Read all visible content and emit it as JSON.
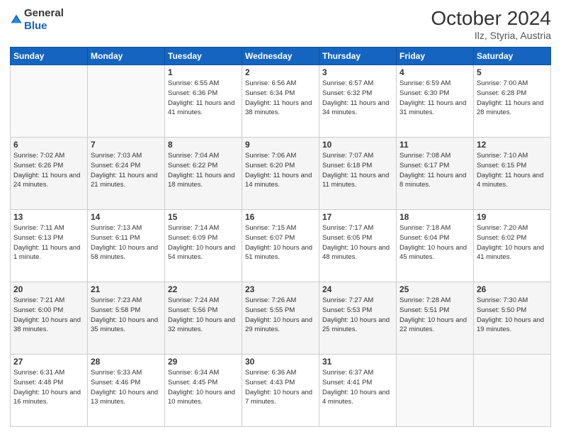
{
  "logo": {
    "text_general": "General",
    "text_blue": "Blue"
  },
  "title": {
    "month_year": "October 2024",
    "location": "Ilz, Styria, Austria"
  },
  "weekdays": [
    "Sunday",
    "Monday",
    "Tuesday",
    "Wednesday",
    "Thursday",
    "Friday",
    "Saturday"
  ],
  "weeks": [
    [
      {
        "day": "",
        "info": ""
      },
      {
        "day": "",
        "info": ""
      },
      {
        "day": "1",
        "info": "Sunrise: 6:55 AM\nSunset: 6:36 PM\nDaylight: 11 hours and 41 minutes."
      },
      {
        "day": "2",
        "info": "Sunrise: 6:56 AM\nSunset: 6:34 PM\nDaylight: 11 hours and 38 minutes."
      },
      {
        "day": "3",
        "info": "Sunrise: 6:57 AM\nSunset: 6:32 PM\nDaylight: 11 hours and 34 minutes."
      },
      {
        "day": "4",
        "info": "Sunrise: 6:59 AM\nSunset: 6:30 PM\nDaylight: 11 hours and 31 minutes."
      },
      {
        "day": "5",
        "info": "Sunrise: 7:00 AM\nSunset: 6:28 PM\nDaylight: 11 hours and 28 minutes."
      }
    ],
    [
      {
        "day": "6",
        "info": "Sunrise: 7:02 AM\nSunset: 6:26 PM\nDaylight: 11 hours and 24 minutes."
      },
      {
        "day": "7",
        "info": "Sunrise: 7:03 AM\nSunset: 6:24 PM\nDaylight: 11 hours and 21 minutes."
      },
      {
        "day": "8",
        "info": "Sunrise: 7:04 AM\nSunset: 6:22 PM\nDaylight: 11 hours and 18 minutes."
      },
      {
        "day": "9",
        "info": "Sunrise: 7:06 AM\nSunset: 6:20 PM\nDaylight: 11 hours and 14 minutes."
      },
      {
        "day": "10",
        "info": "Sunrise: 7:07 AM\nSunset: 6:18 PM\nDaylight: 11 hours and 11 minutes."
      },
      {
        "day": "11",
        "info": "Sunrise: 7:08 AM\nSunset: 6:17 PM\nDaylight: 11 hours and 8 minutes."
      },
      {
        "day": "12",
        "info": "Sunrise: 7:10 AM\nSunset: 6:15 PM\nDaylight: 11 hours and 4 minutes."
      }
    ],
    [
      {
        "day": "13",
        "info": "Sunrise: 7:11 AM\nSunset: 6:13 PM\nDaylight: 11 hours and 1 minute."
      },
      {
        "day": "14",
        "info": "Sunrise: 7:13 AM\nSunset: 6:11 PM\nDaylight: 10 hours and 58 minutes."
      },
      {
        "day": "15",
        "info": "Sunrise: 7:14 AM\nSunset: 6:09 PM\nDaylight: 10 hours and 54 minutes."
      },
      {
        "day": "16",
        "info": "Sunrise: 7:15 AM\nSunset: 6:07 PM\nDaylight: 10 hours and 51 minutes."
      },
      {
        "day": "17",
        "info": "Sunrise: 7:17 AM\nSunset: 6:05 PM\nDaylight: 10 hours and 48 minutes."
      },
      {
        "day": "18",
        "info": "Sunrise: 7:18 AM\nSunset: 6:04 PM\nDaylight: 10 hours and 45 minutes."
      },
      {
        "day": "19",
        "info": "Sunrise: 7:20 AM\nSunset: 6:02 PM\nDaylight: 10 hours and 41 minutes."
      }
    ],
    [
      {
        "day": "20",
        "info": "Sunrise: 7:21 AM\nSunset: 6:00 PM\nDaylight: 10 hours and 38 minutes."
      },
      {
        "day": "21",
        "info": "Sunrise: 7:23 AM\nSunset: 5:58 PM\nDaylight: 10 hours and 35 minutes."
      },
      {
        "day": "22",
        "info": "Sunrise: 7:24 AM\nSunset: 5:56 PM\nDaylight: 10 hours and 32 minutes."
      },
      {
        "day": "23",
        "info": "Sunrise: 7:26 AM\nSunset: 5:55 PM\nDaylight: 10 hours and 29 minutes."
      },
      {
        "day": "24",
        "info": "Sunrise: 7:27 AM\nSunset: 5:53 PM\nDaylight: 10 hours and 25 minutes."
      },
      {
        "day": "25",
        "info": "Sunrise: 7:28 AM\nSunset: 5:51 PM\nDaylight: 10 hours and 22 minutes."
      },
      {
        "day": "26",
        "info": "Sunrise: 7:30 AM\nSunset: 5:50 PM\nDaylight: 10 hours and 19 minutes."
      }
    ],
    [
      {
        "day": "27",
        "info": "Sunrise: 6:31 AM\nSunset: 4:48 PM\nDaylight: 10 hours and 16 minutes."
      },
      {
        "day": "28",
        "info": "Sunrise: 6:33 AM\nSunset: 4:46 PM\nDaylight: 10 hours and 13 minutes."
      },
      {
        "day": "29",
        "info": "Sunrise: 6:34 AM\nSunset: 4:45 PM\nDaylight: 10 hours and 10 minutes."
      },
      {
        "day": "30",
        "info": "Sunrise: 6:36 AM\nSunset: 4:43 PM\nDaylight: 10 hours and 7 minutes."
      },
      {
        "day": "31",
        "info": "Sunrise: 6:37 AM\nSunset: 4:41 PM\nDaylight: 10 hours and 4 minutes."
      },
      {
        "day": "",
        "info": ""
      },
      {
        "day": "",
        "info": ""
      }
    ]
  ]
}
